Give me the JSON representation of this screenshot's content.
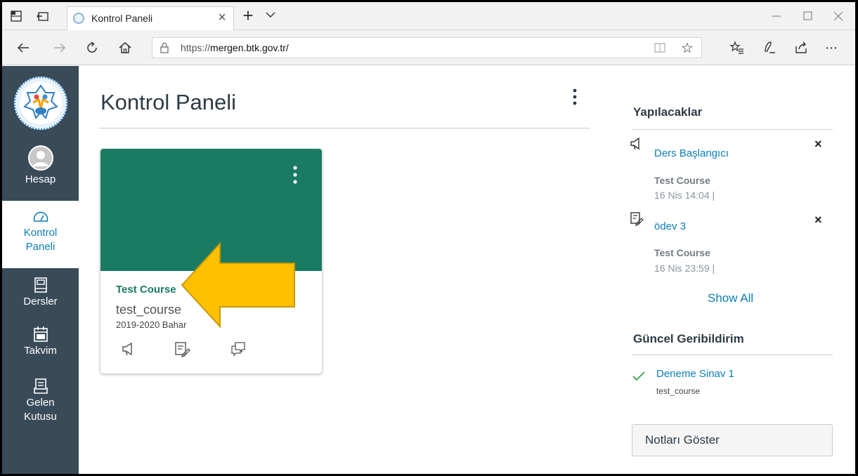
{
  "browser": {
    "tab_title": "Kontrol Paneli",
    "tab_close": "×",
    "new_tab": "+",
    "url_prefix": "https://",
    "url_host": "mergen.btk.gov.tr/",
    "url_full": "https://mergen.btk.gov.tr/"
  },
  "sidebar": {
    "items": [
      {
        "label": "Hesap",
        "icon": "user-avatar-icon"
      },
      {
        "label": "Kontrol Paneli",
        "icon": "dashboard-gauge-icon",
        "active": true
      },
      {
        "label": "Dersler",
        "icon": "book-icon"
      },
      {
        "label": "Takvim",
        "icon": "calendar-icon"
      },
      {
        "label": "Gelen Kutusu",
        "icon": "inbox-icon"
      }
    ],
    "color": "#394b58"
  },
  "main": {
    "title": "Kontrol Paneli"
  },
  "course_card": {
    "name": "Test Course",
    "code": "test_course",
    "term": "2019-2020 Bahar",
    "color": "#1a7a62",
    "actions": [
      "announcement-icon",
      "assignment-icon",
      "discussion-icon"
    ]
  },
  "todo": {
    "heading": "Yapılacaklar",
    "items": [
      {
        "icon": "announcement-icon",
        "title": "Ders Başlangıcı",
        "course": "Test Course",
        "date": "16 Nis 14:04  |"
      },
      {
        "icon": "assignment-icon",
        "title": "ödev 3",
        "course": "Test Course",
        "date": "16 Nis 23:59  |"
      }
    ],
    "dismiss": "×",
    "show_all": "Show All"
  },
  "feedback": {
    "heading": "Güncel Geribildirim",
    "items": [
      {
        "title": "Deneme Sinav 1",
        "course": "test_course"
      }
    ]
  },
  "grades_button": "Notları Göster",
  "colors": {
    "link": "#0b7db8",
    "arrow": "#ffc000",
    "arrow_outline": "#c99a00",
    "check": "#2a9d3a"
  }
}
